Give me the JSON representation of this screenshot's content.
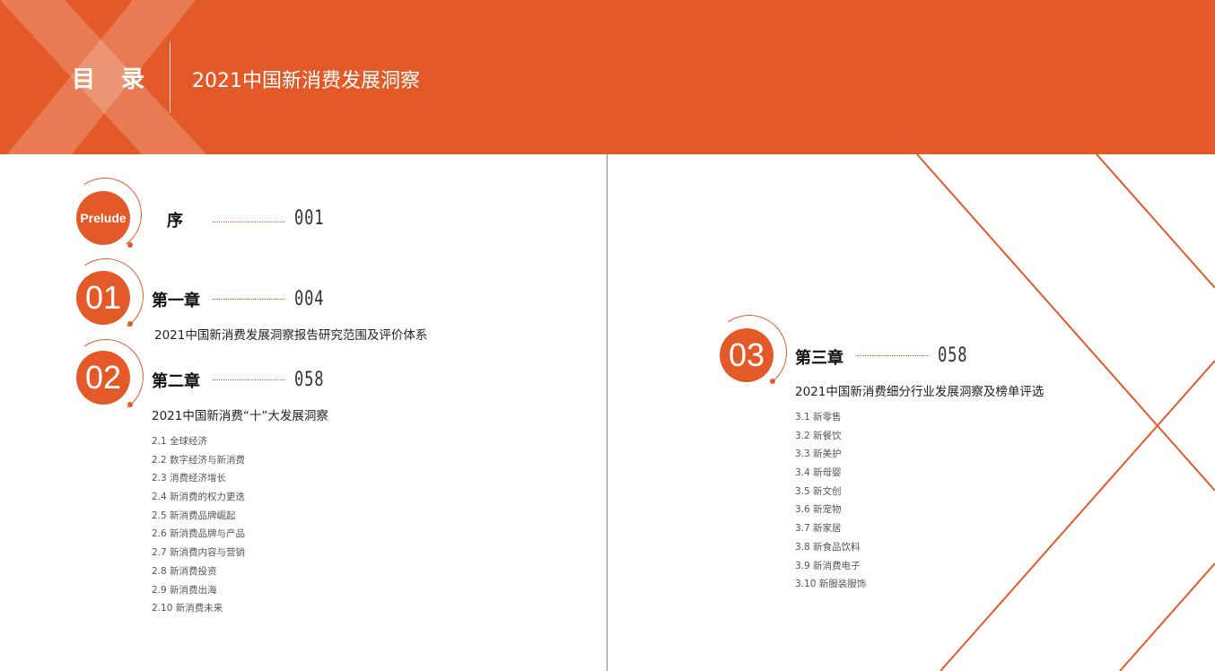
{
  "header": {
    "title": "目 录",
    "subtitle": "2021中国新消费发展洞察"
  },
  "colors": {
    "accent": "#e35a28",
    "text": "#222222",
    "muted": "#555555"
  },
  "prelude": {
    "badge": "Prelude",
    "title": "序",
    "page": "001"
  },
  "chapters": [
    {
      "badge": "01",
      "title": "第一章",
      "page": "004",
      "subtitle": "2021中国新消费发展洞察报告研究范围及评价体系",
      "sections": []
    },
    {
      "badge": "02",
      "title": "第二章",
      "page": "058",
      "subtitle": "2021中国新消费“十”大发展洞察",
      "sections": [
        "2.1 全球经济",
        "2.2 数字经济与新消费",
        "2.3 消费经济增长",
        "2.4 新消费的权力更迭",
        "2.5 新消费品牌崛起",
        "2.6 新消费品牌与产品",
        "2.7 新消费内容与营销",
        "2.8 新消费投资",
        "2.9 新消费出海",
        "2.10 新消费未来"
      ]
    },
    {
      "badge": "03",
      "title": "第三章",
      "page": "058",
      "subtitle": "2021中国新消费细分行业发展洞察及榜单评选",
      "sections": [
        "3.1 新零售",
        "3.2 新餐饮",
        "3.3 新美护",
        "3.4 新母婴",
        "3.5 新文创",
        "3.6 新宠物",
        "3.7 新家居",
        "3.8 新食品饮料",
        "3.9 新消费电子",
        "3.10 新服装服饰"
      ]
    }
  ]
}
